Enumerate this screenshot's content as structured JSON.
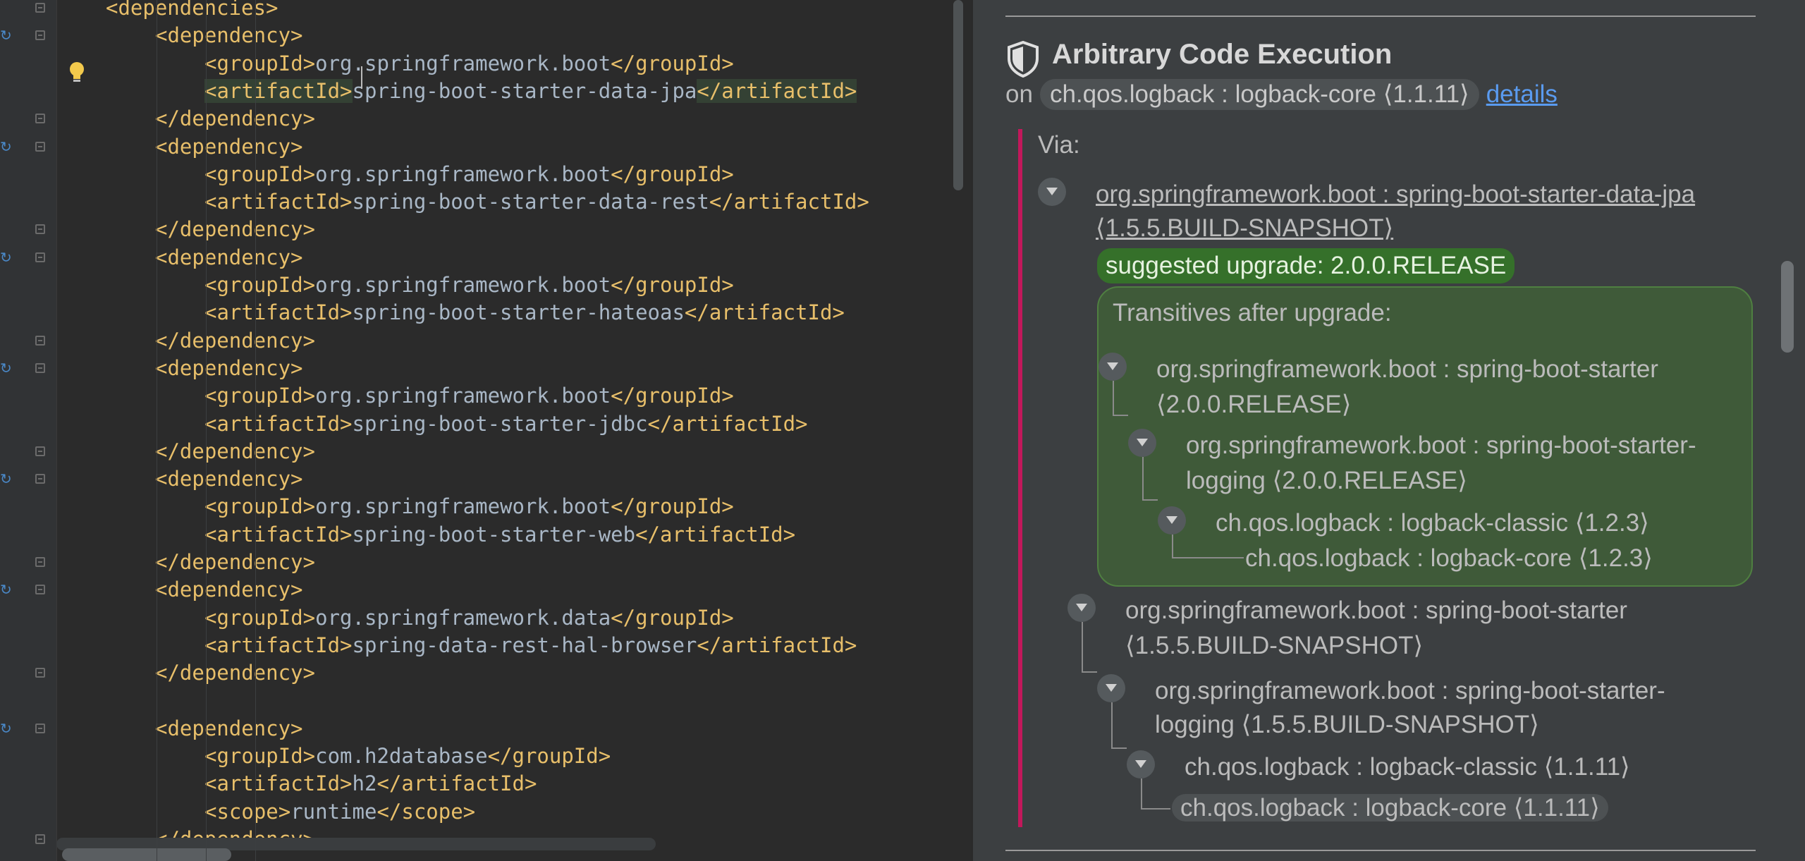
{
  "editor": {
    "lines": [
      {
        "indent": 4,
        "parts": [
          [
            "tag",
            "<dependencies>"
          ]
        ]
      },
      {
        "indent": 8,
        "parts": [
          [
            "tag",
            "<dependency>"
          ]
        ]
      },
      {
        "indent": 12,
        "parts": [
          [
            "tag",
            "<groupId>"
          ],
          [
            "val",
            "org.springframework.boot"
          ],
          [
            "tag",
            "</groupId>"
          ]
        ]
      },
      {
        "indent": 12,
        "parts": [
          [
            "tag",
            "<artifactId>"
          ],
          [
            "val",
            "spring-boot-starter-data-jpa"
          ],
          [
            "tag",
            "</artifactId>"
          ]
        ]
      },
      {
        "indent": 8,
        "parts": [
          [
            "tag",
            "</dependency>"
          ]
        ]
      },
      {
        "indent": 8,
        "parts": [
          [
            "tag",
            "<dependency>"
          ]
        ]
      },
      {
        "indent": 12,
        "parts": [
          [
            "tag",
            "<groupId>"
          ],
          [
            "val",
            "org.springframework.boot"
          ],
          [
            "tag",
            "</groupId>"
          ]
        ]
      },
      {
        "indent": 12,
        "parts": [
          [
            "tag",
            "<artifactId>"
          ],
          [
            "val",
            "spring-boot-starter-data-rest"
          ],
          [
            "tag",
            "</artifactId>"
          ]
        ]
      },
      {
        "indent": 8,
        "parts": [
          [
            "tag",
            "</dependency>"
          ]
        ]
      },
      {
        "indent": 8,
        "parts": [
          [
            "tag",
            "<dependency>"
          ]
        ]
      },
      {
        "indent": 12,
        "parts": [
          [
            "tag",
            "<groupId>"
          ],
          [
            "val",
            "org.springframework.boot"
          ],
          [
            "tag",
            "</groupId>"
          ]
        ]
      },
      {
        "indent": 12,
        "parts": [
          [
            "tag",
            "<artifactId>"
          ],
          [
            "val",
            "spring-boot-starter-hateoas"
          ],
          [
            "tag",
            "</artifactId>"
          ]
        ]
      },
      {
        "indent": 8,
        "parts": [
          [
            "tag",
            "</dependency>"
          ]
        ]
      },
      {
        "indent": 8,
        "parts": [
          [
            "tag",
            "<dependency>"
          ]
        ]
      },
      {
        "indent": 12,
        "parts": [
          [
            "tag",
            "<groupId>"
          ],
          [
            "val",
            "org.springframework.boot"
          ],
          [
            "tag",
            "</groupId>"
          ]
        ]
      },
      {
        "indent": 12,
        "parts": [
          [
            "tag",
            "<artifactId>"
          ],
          [
            "val",
            "spring-boot-starter-jdbc"
          ],
          [
            "tag",
            "</artifactId>"
          ]
        ]
      },
      {
        "indent": 8,
        "parts": [
          [
            "tag",
            "</dependency>"
          ]
        ]
      },
      {
        "indent": 8,
        "parts": [
          [
            "tag",
            "<dependency>"
          ]
        ]
      },
      {
        "indent": 12,
        "parts": [
          [
            "tag",
            "<groupId>"
          ],
          [
            "val",
            "org.springframework.boot"
          ],
          [
            "tag",
            "</groupId>"
          ]
        ]
      },
      {
        "indent": 12,
        "parts": [
          [
            "tag",
            "<artifactId>"
          ],
          [
            "val",
            "spring-boot-starter-web"
          ],
          [
            "tag",
            "</artifactId>"
          ]
        ]
      },
      {
        "indent": 8,
        "parts": [
          [
            "tag",
            "</dependency>"
          ]
        ]
      },
      {
        "indent": 8,
        "parts": [
          [
            "tag",
            "<dependency>"
          ]
        ]
      },
      {
        "indent": 12,
        "parts": [
          [
            "tag",
            "<groupId>"
          ],
          [
            "val",
            "org.springframework.data"
          ],
          [
            "tag",
            "</groupId>"
          ]
        ]
      },
      {
        "indent": 12,
        "parts": [
          [
            "tag",
            "<artifactId>"
          ],
          [
            "val",
            "spring-data-rest-hal-browser"
          ],
          [
            "tag",
            "</artifactId>"
          ]
        ]
      },
      {
        "indent": 8,
        "parts": [
          [
            "tag",
            "</dependency>"
          ]
        ]
      },
      {
        "indent": 0,
        "parts": []
      },
      {
        "indent": 8,
        "parts": [
          [
            "tag",
            "<dependency>"
          ]
        ]
      },
      {
        "indent": 12,
        "parts": [
          [
            "tag",
            "<groupId>"
          ],
          [
            "val",
            "com.h2database"
          ],
          [
            "tag",
            "</groupId>"
          ]
        ]
      },
      {
        "indent": 12,
        "parts": [
          [
            "tag",
            "<artifactId>"
          ],
          [
            "val",
            "h2"
          ],
          [
            "tag",
            "</artifactId>"
          ]
        ]
      },
      {
        "indent": 12,
        "parts": [
          [
            "tag",
            "<scope>"
          ],
          [
            "val",
            "runtime"
          ],
          [
            "tag",
            "</scope>"
          ]
        ]
      },
      {
        "indent": 8,
        "parts": [
          [
            "tag",
            "</dependency>"
          ]
        ]
      }
    ]
  },
  "vuln": {
    "title": "Arbitrary Code Execution",
    "on_prefix": "on",
    "package": "ch.qos.logback : logback-core ⟨1.1.11⟩",
    "details_link": "details",
    "via_label": "Via:",
    "root_line1": "org.springframework.boot : spring-boot-starter-data-jpa",
    "root_line2": "⟨1.5.5.BUILD-SNAPSHOT⟩",
    "upgrade": "suggested upgrade: 2.0.0.RELEASE",
    "transitives_label": "Transitives after upgrade:",
    "after": [
      {
        "line1": "org.springframework.boot : spring-boot-starter",
        "line2": "⟨2.0.0.RELEASE⟩"
      },
      {
        "line1": "org.springframework.boot : spring-boot-starter-",
        "line2": "logging ⟨2.0.0.RELEASE⟩"
      },
      {
        "line1": "ch.qos.logback : logback-classic ⟨1.2.3⟩",
        "line2": ""
      },
      {
        "line1": "ch.qos.logback : logback-core ⟨1.2.3⟩",
        "line2": ""
      }
    ],
    "current": [
      {
        "line1": "org.springframework.boot : spring-boot-starter",
        "line2": "⟨1.5.5.BUILD-SNAPSHOT⟩"
      },
      {
        "line1": "org.springframework.boot : spring-boot-starter-",
        "line2": "logging ⟨1.5.5.BUILD-SNAPSHOT⟩"
      },
      {
        "line1": "ch.qos.logback : logback-classic ⟨1.1.11⟩",
        "line2": ""
      },
      {
        "line1": "ch.qos.logback : logback-core ⟨1.1.11⟩",
        "line2": ""
      }
    ]
  },
  "colors": {
    "tag": "#e8bf6a",
    "value": "#a9b7c6",
    "link": "#5a9bf0",
    "upgrade": "#35702a",
    "via_bar": "#c2185b"
  }
}
